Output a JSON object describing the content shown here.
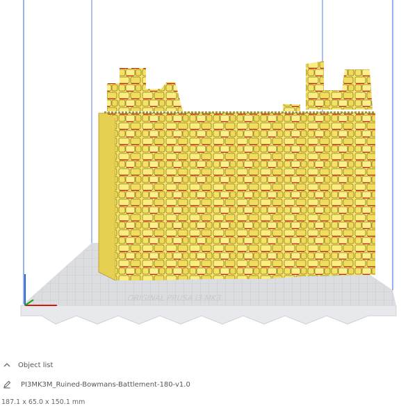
{
  "viewport": {
    "background": "#ffffff",
    "model_color": "#f5e46a",
    "overhang_color": "#d01818",
    "build_plate_color": "#dcdde0",
    "plate_text": "ORIGINAL PRUSA i3 MK3"
  },
  "object_list": {
    "header_label": "Object list",
    "object_name": "PI3MK3M_Ruined-Bowmans-Battlement-180-v1.0",
    "dimensions": "187.1 x 65.0 x 150.1 mm"
  }
}
